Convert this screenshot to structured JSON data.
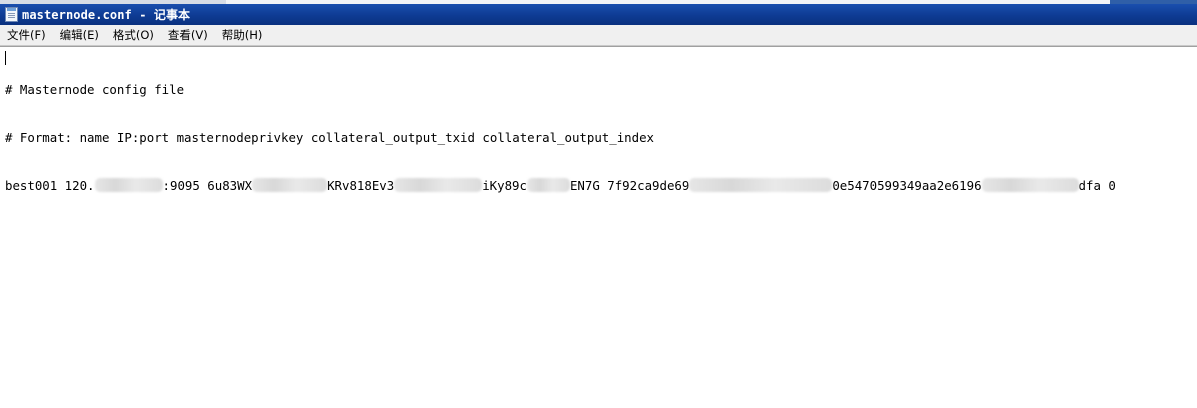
{
  "window": {
    "title": "masternode.conf - 记事本"
  },
  "menu": {
    "items": [
      "文件(F)",
      "编辑(E)",
      "格式(O)",
      "查看(V)",
      "帮助(H)"
    ]
  },
  "document": {
    "line1": "# Masternode config file",
    "line2": "# Format: name IP:port masternodeprivkey collateral_output_txid collateral_output_index",
    "line3": {
      "seg1": "best001 120.",
      "seg2": ":9095 6u83WX",
      "seg3": "KRv818Ev3",
      "seg4": "iKy89c",
      "seg5": "EN7G 7f92ca9de69",
      "seg6": "0e5470599349aa2e6196",
      "seg7": "dfa 0"
    }
  },
  "colors": {
    "title_bar": "#0e3b93",
    "menu_bar": "#f0f0f0",
    "editor_bg": "#ffffff"
  }
}
